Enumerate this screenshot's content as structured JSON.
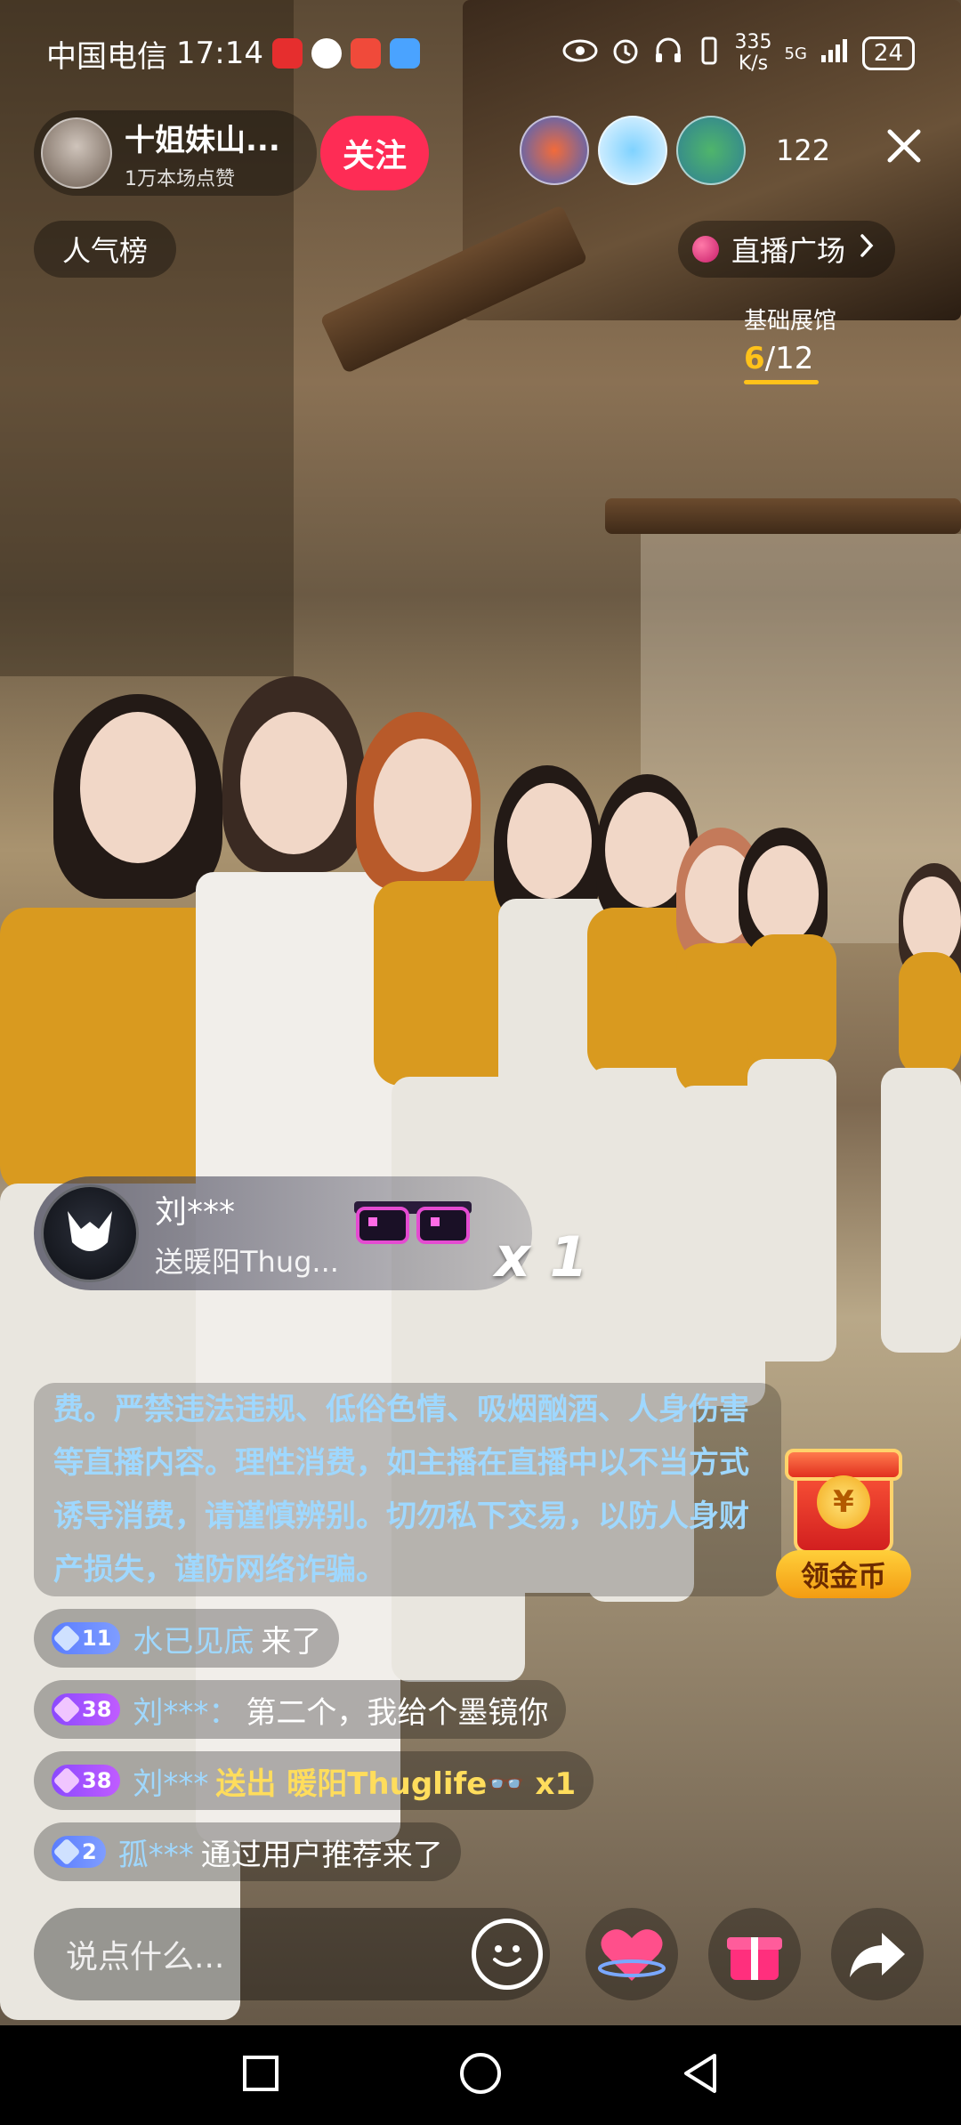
{
  "status_bar": {
    "carrier": "中国电信",
    "time": "17:14",
    "net_speed_value": "335",
    "net_speed_unit": "K/s",
    "network": "5G",
    "battery": "24"
  },
  "host": {
    "name": "十姐妹山...",
    "likes": "1万本场点赞",
    "follow_label": "关注"
  },
  "viewer_count": "122",
  "rank_label": "人气榜",
  "plaza_label": "直播广场",
  "exhibit": {
    "title": "基础展馆",
    "current": "6",
    "total": "/12"
  },
  "gift_banner": {
    "user": "刘***",
    "desc": "送暖阳Thug...",
    "count": "x 1"
  },
  "notice": {
    "text": "费。严禁违法违规、低俗色情、吸烟酗酒、人身伤害等直播内容。理性消费，如主播在直播中以不当方式诱导消费，请谨慎辨别。切勿私下交易，以防人身财产损失，谨防网络诈骗。"
  },
  "coin_label": "领金币",
  "coin_symbol": "¥",
  "chat": [
    {
      "level": "11",
      "level_style": "blue",
      "user": "水已见底",
      "msg": "来了",
      "gift": ""
    },
    {
      "level": "38",
      "level_style": "purple",
      "user": "刘***：",
      "msg": "第二个，我给个墨镜你",
      "gift": ""
    },
    {
      "level": "38",
      "level_style": "purple",
      "user": "刘***",
      "msg": "",
      "gift": "送出 暖阳Thuglife👓 x1"
    },
    {
      "level": "2",
      "level_style": "blue",
      "user": "孤***",
      "msg": "通过用户推荐来了",
      "gift": ""
    }
  ],
  "input": {
    "placeholder": "说点什么..."
  },
  "icons": {
    "eye": "eye-icon",
    "alarm": "alarm-icon",
    "headphones": "headphones-icon",
    "emoji": "emoji-icon",
    "heart": "heart-icon",
    "gift": "gift-icon",
    "share": "share-icon",
    "close": "close-icon",
    "chevron": "chevron-right-icon"
  },
  "colors": {
    "follow": "#fe2c55",
    "accent_gold": "#ffc21a",
    "chat_user": "#9fd8ff",
    "notice_text": "#9fd8ff"
  }
}
